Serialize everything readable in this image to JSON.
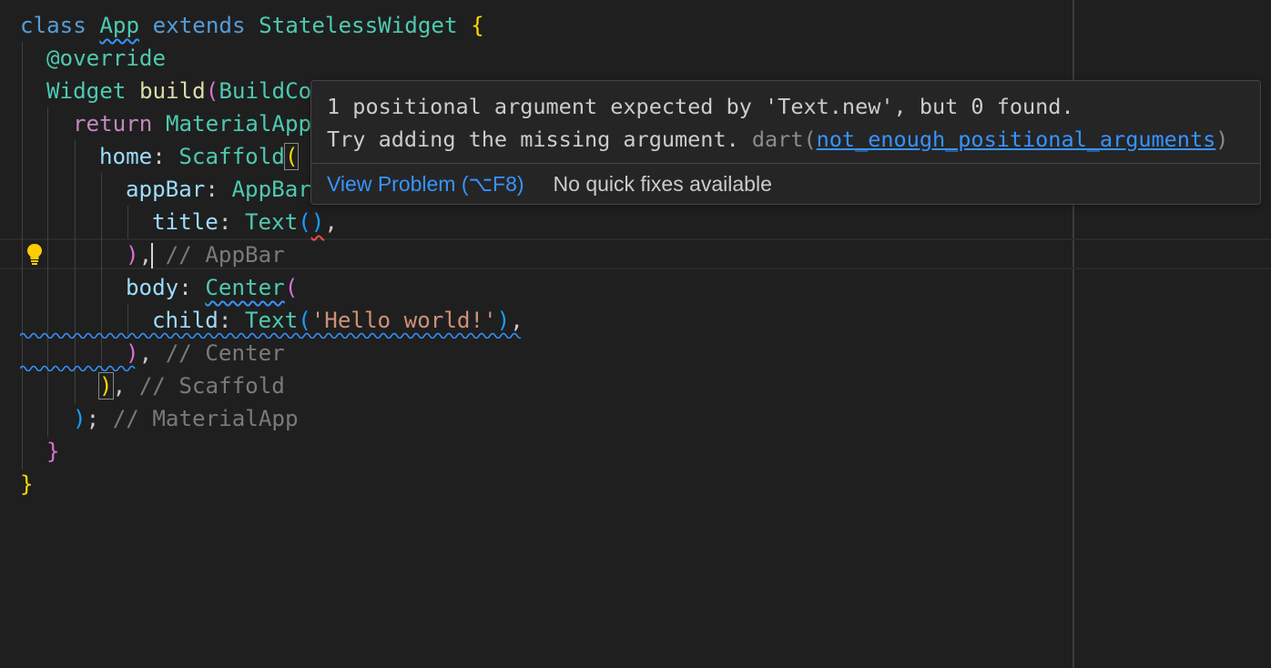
{
  "editor": {
    "language": "dart",
    "lines": [
      "class App extends StatelessWidget {",
      "  @override",
      "  Widget build(BuildContext context) {",
      "    return MaterialApp(",
      "      home: Scaffold(",
      "        appBar: AppBar(",
      "          title: Text(),",
      "        ), // AppBar",
      "        body: Center(",
      "          child: Text('Hello world!'),",
      "        ), // Center",
      "      ), // Scaffold",
      "    ); // MaterialApp",
      "  }",
      "}"
    ],
    "tokens": {
      "l1": {
        "class": "class",
        "app": "App",
        "extends": "extends",
        "stateless": "StatelessWidget",
        "brace": "{"
      },
      "l2": {
        "override": "@override"
      },
      "l3": {
        "widget": "Widget",
        "build": "build",
        "paren": "(",
        "buildco": "BuildCo"
      },
      "l4": {
        "ret": "return",
        "material": "MaterialApp"
      },
      "l5": {
        "home": "home",
        "colon": ": ",
        "scaffold": "Scaffold",
        "paren": "("
      },
      "l6": {
        "appbar_key": "appBar",
        "colon": ": ",
        "appbar": "AppBar"
      },
      "l7": {
        "title": "title",
        "colon": ": ",
        "text": "Text",
        "open": "(",
        "close": ")",
        "comma": ","
      },
      "l8": {
        "close": ")",
        "comma": ",",
        "comment": " // AppBar"
      },
      "l9": {
        "body": "body",
        "colon": ": ",
        "center": "Center",
        "paren": "("
      },
      "l10": {
        "child": "child",
        "colon": ": ",
        "text": "Text",
        "open": "(",
        "str": "'Hello world!'",
        "close": ")",
        "comma": ","
      },
      "l11": {
        "close": ")",
        "rest": ", ",
        "comment": "// Center"
      },
      "l12": {
        "close": ")",
        "rest": ", ",
        "comment": "// Scaffold"
      },
      "l13": {
        "close": ")",
        "rest": "; ",
        "comment": "// MaterialApp"
      },
      "l14": {
        "brace": "}"
      },
      "l15": {
        "brace": "}"
      }
    }
  },
  "hover": {
    "message_line1": "1 positional argument expected by 'Text.new', but 0 found.",
    "message_line2": "Try adding the missing argument. ",
    "source": "dart",
    "source_open": "(",
    "code_link": "not_enough_positional_arguments",
    "source_close": ")",
    "view_problem": "View Problem (⌥F8)",
    "no_quick_fixes": "No quick fixes available"
  },
  "icons": {
    "lightbulb": "lightbulb-icon"
  },
  "colors": {
    "background": "#1f1f1f",
    "keyword": "#569cd6",
    "type": "#4ec9b0",
    "function": "#dcdcaa",
    "property": "#9cdcfe",
    "string": "#ce9178",
    "comment": "#7a7a7a",
    "bracket_gold": "#ffd700",
    "bracket_pink": "#da70d6",
    "bracket_blue": "#179fff",
    "link": "#3794ff",
    "lightbulb": "#ffcc00"
  }
}
